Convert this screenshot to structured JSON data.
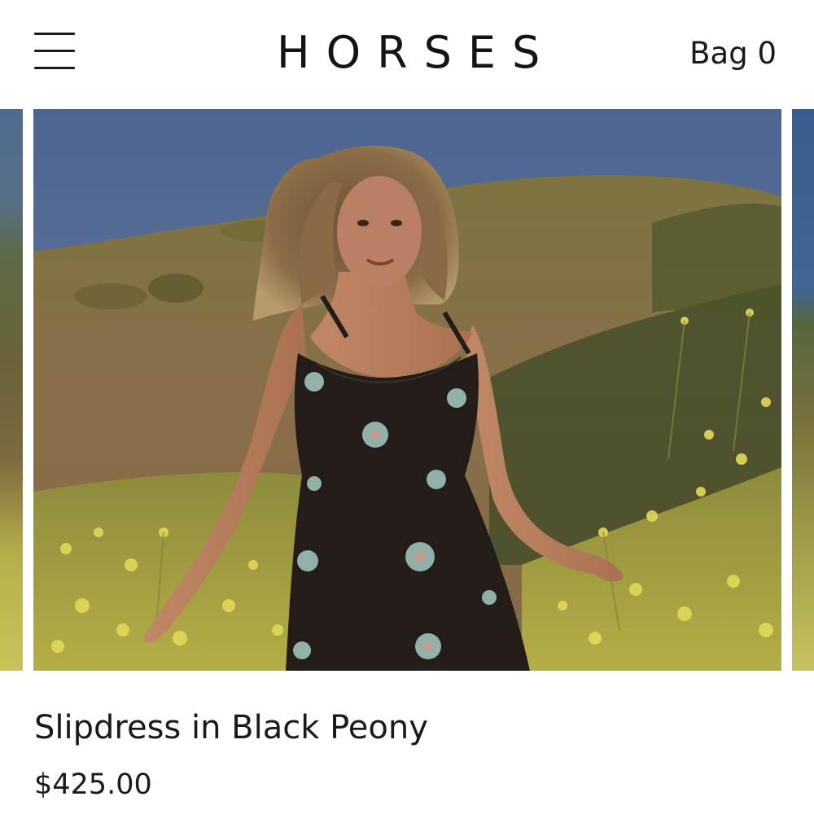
{
  "header": {
    "logo_text": "HORSES",
    "bag_label": "Bag 0",
    "menu_icon": "hamburger-menu-icon"
  },
  "product": {
    "image_description_icon": "product-photo",
    "title": "Slipdress in Black Peony",
    "price": "$425.00"
  },
  "colors": {
    "background": "#ffffff",
    "text": "#1a1a1a",
    "sky": "#4f6794",
    "dress": "#231c18",
    "flowers": "#c8c24e"
  }
}
